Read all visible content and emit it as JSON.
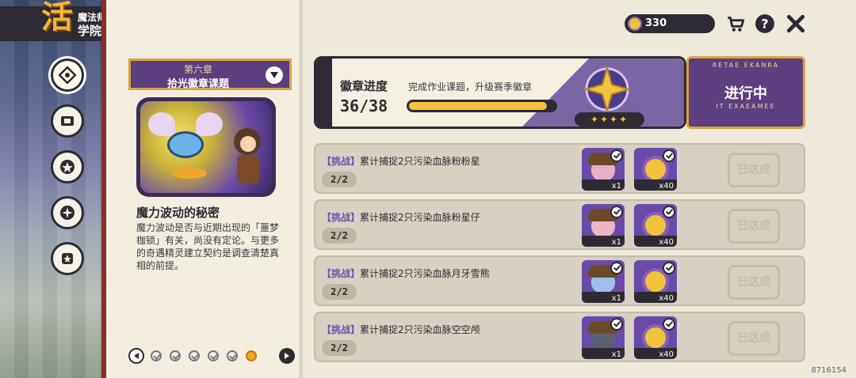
{
  "header": {
    "logo_char": "活",
    "subtitle": "魔法师手册",
    "title": "学院作业"
  },
  "nav": {
    "items": [
      {
        "name": "nav-tasks",
        "icon": "compass-icon"
      },
      {
        "name": "nav-cards",
        "icon": "card-icon"
      },
      {
        "name": "nav-star-badge",
        "icon": "star-badge-icon"
      },
      {
        "name": "nav-collect",
        "icon": "spark-icon"
      },
      {
        "name": "nav-achievement",
        "icon": "star-scroll-icon"
      }
    ]
  },
  "chapter": {
    "number": "第六章",
    "name": "拾光徽章课题"
  },
  "lore": {
    "title": "魔力波动的秘密",
    "text": "魔力波动是否与近期出现的「噩梦枷锁」有关，尚没有定论。与更多的奇遇精灵建立契约是调查清楚真相的前提。"
  },
  "pager": {
    "dots": [
      "done",
      "done",
      "done",
      "done",
      "done",
      "current"
    ]
  },
  "currency": {
    "value": "330",
    "icon": "star-coin-icon"
  },
  "top_actions": [
    {
      "name": "shop-button",
      "icon": "cart-icon"
    },
    {
      "name": "help-button",
      "icon": "question-icon"
    },
    {
      "name": "close-button",
      "icon": "close-icon"
    }
  ],
  "progress": {
    "title": "徽章进度",
    "description": "完成作业课题，升级赛季徽章",
    "current": 36,
    "total": 38,
    "count_text": "36/38",
    "fraction": 0.947,
    "stars": "✦✦✦✦"
  },
  "status": {
    "label": "进行中",
    "deco_top": "RETAE EKANRA",
    "deco_bottom": "IT EXAEAMEE"
  },
  "tasks": [
    {
      "tag": "【挑战】",
      "text": "累计捕捉2只污染血脉粉粉星",
      "count": "2/2",
      "rewards": [
        {
          "type": "acorn",
          "qty": "x1",
          "color": "#e8b0c8"
        },
        {
          "type": "orb",
          "qty": "x40"
        }
      ],
      "stamp": "已达成"
    },
    {
      "tag": "【挑战】",
      "text": "累计捕捉2只污染血脉粉星仔",
      "count": "2/2",
      "rewards": [
        {
          "type": "acorn",
          "qty": "x1",
          "color": "#f0b4c8"
        },
        {
          "type": "orb",
          "qty": "x40"
        }
      ],
      "stamp": "已达成"
    },
    {
      "tag": "【挑战】",
      "text": "累计捕捉2只污染血脉月牙雪熊",
      "count": "2/2",
      "rewards": [
        {
          "type": "acorn",
          "qty": "x1",
          "color": "#9ec0ec"
        },
        {
          "type": "orb",
          "qty": "x40"
        }
      ],
      "stamp": "已达成"
    },
    {
      "tag": "【挑战】",
      "text": "累计捕捉2只污染血脉空空颅",
      "count": "2/2",
      "rewards": [
        {
          "type": "acorn",
          "qty": "x1",
          "color": "#5a6070"
        },
        {
          "type": "orb",
          "qty": "x40"
        }
      ],
      "stamp": "已达成"
    }
  ],
  "footer": {
    "version": "8716154"
  },
  "colors": {
    "dark": "#2d2a33",
    "purple": "#5b3f7e",
    "gold": "#f4c23c",
    "tag": "#6a54b0",
    "paper": "#f3ede0"
  }
}
